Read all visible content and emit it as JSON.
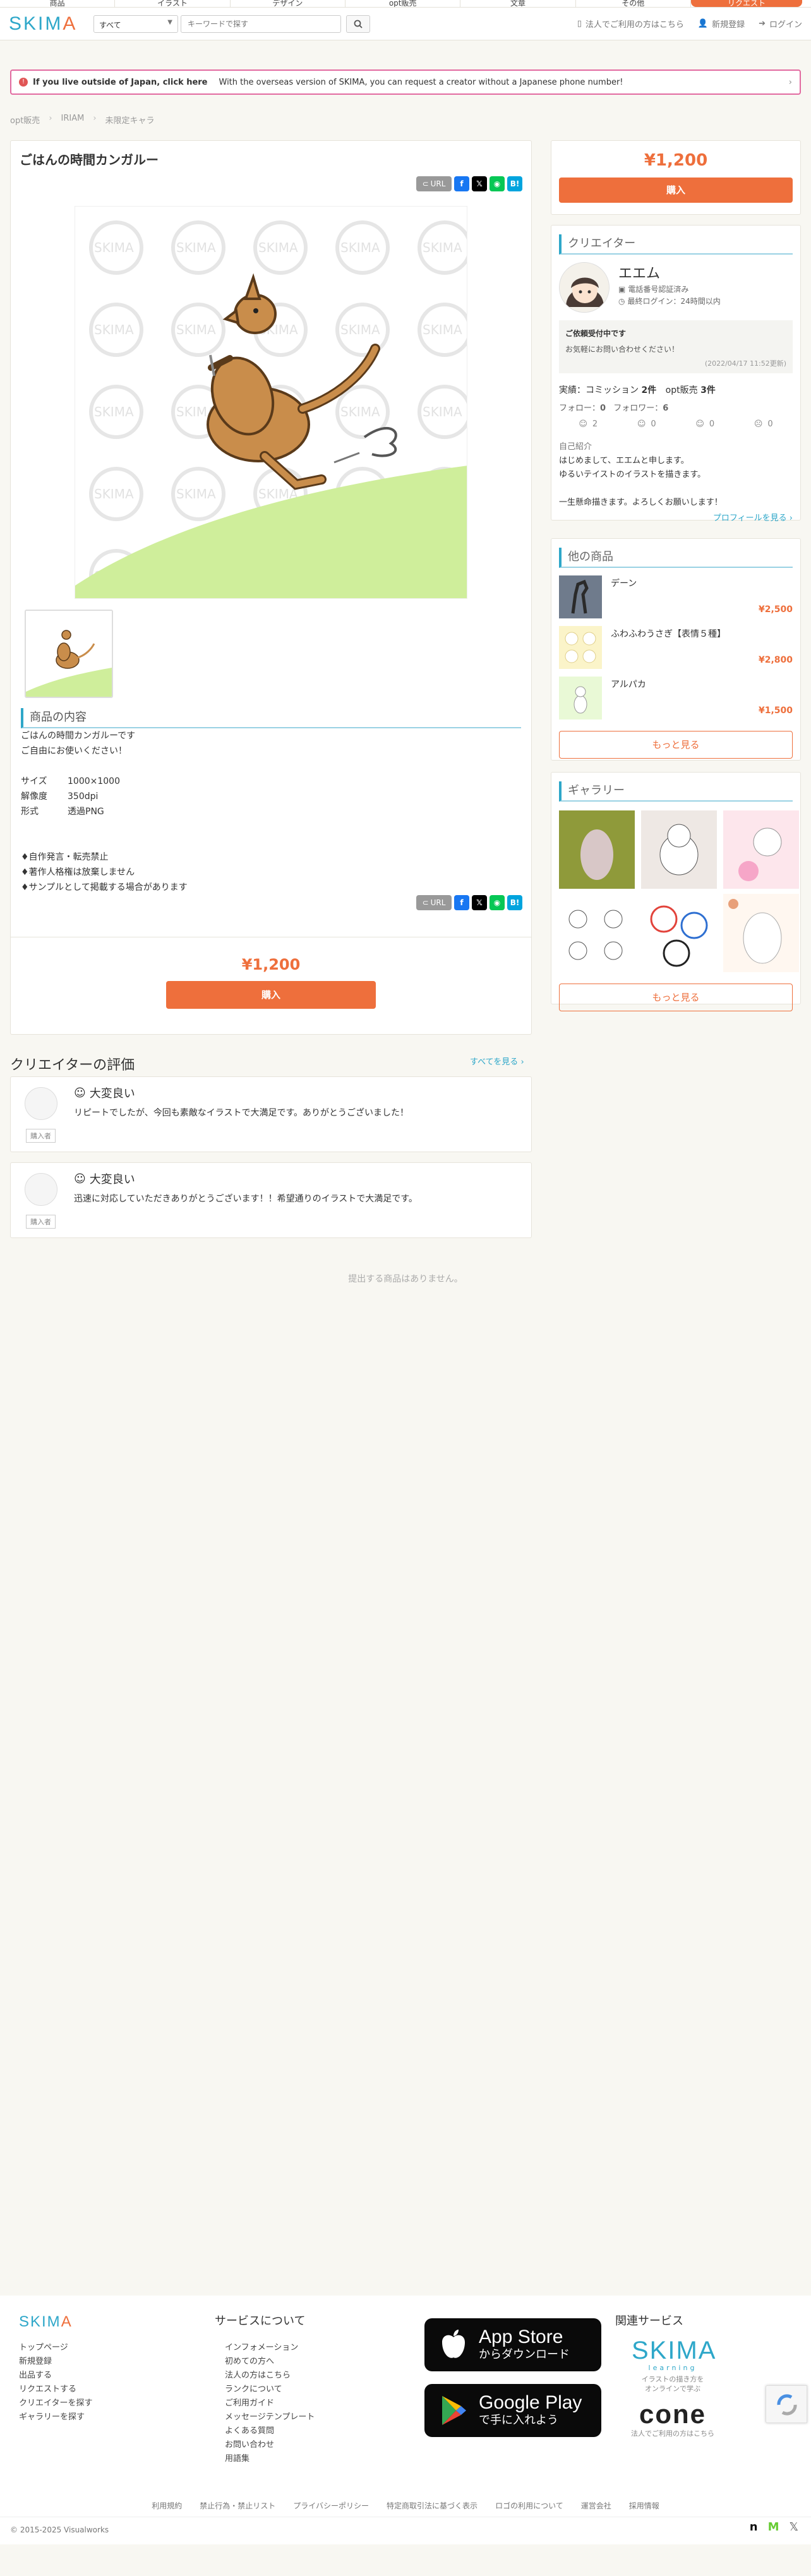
{
  "topnav": {
    "categories": [
      "商品",
      "イラスト",
      "デザイン",
      "opt販売",
      "文章",
      "その他"
    ],
    "cta_label": "リクエスト"
  },
  "header": {
    "logo_text": "SKIMA",
    "search_category": "すべて",
    "search_placeholder": "キーワードで探す",
    "links": {
      "corporate": "法人でご利用の方はこちら",
      "signup": "新規登録",
      "login": "ログイン"
    }
  },
  "overseas_banner": {
    "bold": "If you live outside of Japan, click here",
    "text": "With the overseas version of SKIMA, you can request a creator without a Japanese phone number!"
  },
  "breadcrumb": [
    "opt販売",
    "IRIAM",
    "未限定キャラ"
  ],
  "product": {
    "title": "ごはんの時間カンガルー",
    "url_label": "URL",
    "section_title": "商品の内容",
    "desc_lines": [
      "ごはんの時間カンガルーです",
      "ご自由にお使いください！"
    ],
    "specs": [
      {
        "key": "サイズ",
        "value": "1000×1000"
      },
      {
        "key": "解像度",
        "value": "350dpi"
      },
      {
        "key": "形式",
        "value": "透過PNG"
      }
    ],
    "notes": [
      "♦自作発言・転売禁止",
      "♦著作人格権は放棄しません",
      "♦サンプルとして掲載する場合があります"
    ],
    "price": "¥1,200",
    "buy_label": "購入"
  },
  "sidebar": {
    "price": "¥1,200",
    "buy_label": "購入",
    "creator_heading": "クリエイター",
    "creator_name": "エエム",
    "verified": "電話番号認証済み",
    "last_login": "最終ログイン：24時間以内",
    "notice_title": "ご依頼受付中です",
    "notice_message": "お気軽にお問い合わせください！",
    "notice_date": "(2022/04/17 11:52更新)",
    "stats": {
      "commission_label": "実績：コミッション",
      "commission_count": "2件",
      "opt_label": "opt販売",
      "opt_count": "3件"
    },
    "follow": {
      "follow_label": "フォロー：",
      "follow_count": "0",
      "follower_label": "フォロワー：",
      "follower_count": "6"
    },
    "ratings": [
      "2",
      "0",
      "0",
      "0"
    ],
    "intro_label": "自己紹介",
    "intro_lines": [
      "はじめまして、エエムと申します。",
      "ゆるいテイストのイラストを描きます。",
      "",
      "一生懸命描きます。よろしくお願いします！"
    ],
    "profile_link": "プロフィールを見る ›",
    "others_heading": "他の商品",
    "others": [
      {
        "name": "デーン",
        "price": "¥2,500"
      },
      {
        "name": "ふわふわうさぎ【表情５種】",
        "price": "¥2,800"
      },
      {
        "name": "アルパカ",
        "price": "¥1,500"
      }
    ],
    "more_label": "もっと見る",
    "gallery_heading": "ギャラリー",
    "gallery_more_label": "もっと見る"
  },
  "reviews": {
    "title": "クリエイターの評価",
    "view_all": "すべてを見る ›",
    "items": [
      {
        "rating": "大変良い",
        "text": "リピートでしたが、今回も素敵なイラストで大満足です。ありがとうございました！",
        "role": "購入者"
      },
      {
        "rating": "大変良い",
        "text": "迅速に対応していただきありがとうございます！！希望通りのイラストで大満足です。",
        "role": "購入者"
      }
    ]
  },
  "empty_message": "提出する商品はありません。",
  "footer": {
    "logo": "SKIMA",
    "links_col1": [
      "トップページ",
      "新規登録",
      "出品する",
      "リクエストする",
      "クリエイターを探す",
      "ギャラリーを探す"
    ],
    "service_heading": "サービスについて",
    "links_col2": [
      "インフォメーション",
      "初めての方へ",
      "法人の方はこちら",
      "ランクについて",
      "ご利用ガイド",
      "メッセージテンプレート",
      "よくある質問",
      "お問い合わせ",
      "用語集"
    ],
    "appstore_line1": "App Store",
    "appstore_line2": "からダウンロード",
    "googleplay_line1": "Google Play",
    "googleplay_line2": "で手に入れよう",
    "related_heading": "関連サービス",
    "learning_logo": "SKIMA",
    "learning_sub": "learning",
    "learning_caption1": "イラストの描き方を",
    "learning_caption2": "オンラインで学ぶ",
    "cone_logo": "cone",
    "cone_caption": "法人でご利用の方はこちら",
    "bottom_links": [
      "利用規約",
      "禁止行為・禁止リスト",
      "プライバシーポリシー",
      "特定商取引法に基づく表示",
      "ロゴの利用について",
      "運営会社",
      "採用情報"
    ],
    "copyright": "© 2015-2025 Visualworks"
  }
}
